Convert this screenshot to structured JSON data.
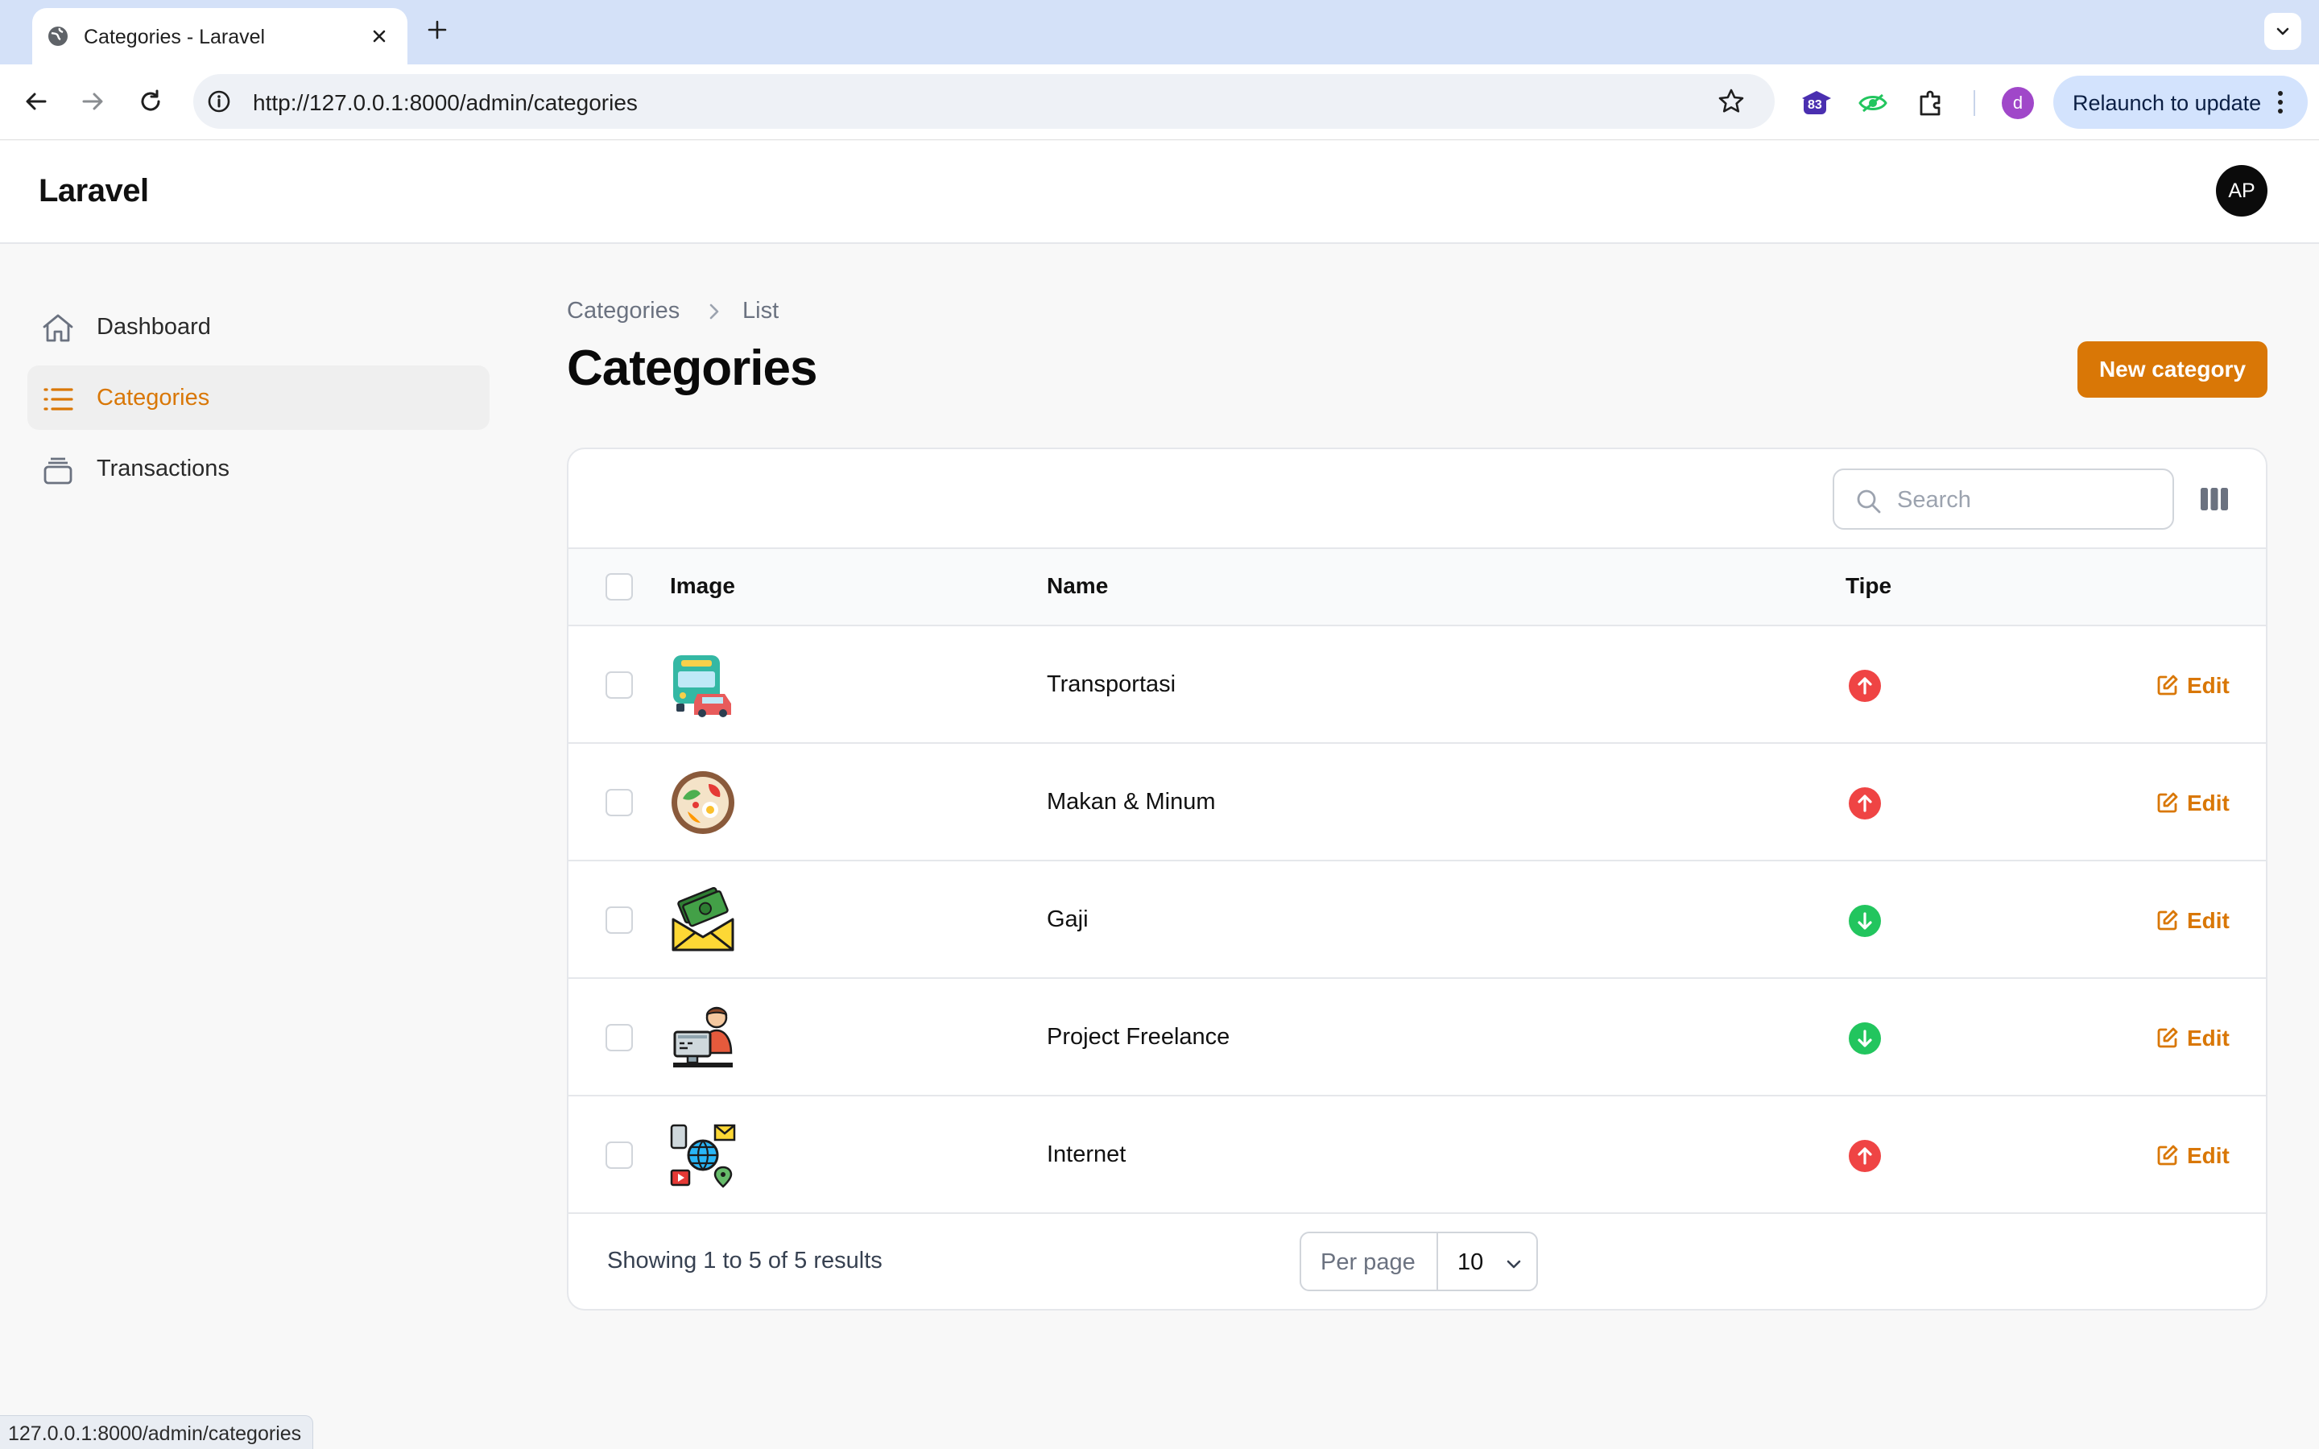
{
  "browser": {
    "tab_title": "Categories - Laravel",
    "url": "http://127.0.0.1:8000/admin/categories",
    "extension_badge": "83",
    "profile_initial": "d",
    "relaunch_label": "Relaunch to update",
    "status_url": "127.0.0.1:8000/admin/categories"
  },
  "app": {
    "brand": "Laravel",
    "user_initials": "AP",
    "accent_color": "#d97706"
  },
  "sidebar": {
    "items": [
      {
        "label": "Dashboard",
        "icon": "home-icon",
        "active": false
      },
      {
        "label": "Categories",
        "icon": "list-icon",
        "active": true
      },
      {
        "label": "Transactions",
        "icon": "stack-icon",
        "active": false
      }
    ]
  },
  "page": {
    "breadcrumbs": [
      "Categories",
      "List"
    ],
    "title": "Categories",
    "new_button": "New category"
  },
  "table": {
    "search_placeholder": "Search",
    "columns": {
      "image": "Image",
      "name": "Name",
      "tipe": "Tipe"
    },
    "edit_label": "Edit",
    "rows": [
      {
        "name": "Transportasi",
        "image": "bus-car-icon",
        "tipe": "expense",
        "tipe_icon": "arrow-up-circle-icon",
        "tipe_color": "#ef4444"
      },
      {
        "name": "Makan & Minum",
        "image": "food-bowl-icon",
        "tipe": "expense",
        "tipe_icon": "arrow-up-circle-icon",
        "tipe_color": "#ef4444"
      },
      {
        "name": "Gaji",
        "image": "money-envelope-icon",
        "tipe": "income",
        "tipe_icon": "arrow-down-circle-icon",
        "tipe_color": "#22c55e"
      },
      {
        "name": "Project Freelance",
        "image": "freelancer-computer-icon",
        "tipe": "income",
        "tipe_icon": "arrow-down-circle-icon",
        "tipe_color": "#22c55e"
      },
      {
        "name": "Internet",
        "image": "globe-network-icon",
        "tipe": "expense",
        "tipe_icon": "arrow-up-circle-icon",
        "tipe_color": "#ef4444"
      }
    ],
    "summary": "Showing 1 to 5 of 5 results",
    "per_page_label": "Per page",
    "per_page_value": "10"
  }
}
